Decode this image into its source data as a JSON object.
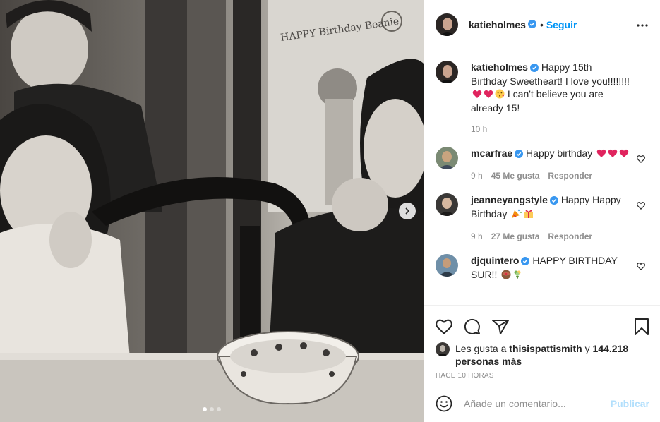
{
  "colors": {
    "accent": "#0095f6",
    "text": "#262626",
    "secondary": "#8e8e8e",
    "verified": "#3897f0",
    "publish_disabled": "#b2dffc",
    "heart_emoji": "#e0245e"
  },
  "media": {
    "caption_on_wall": "HAPPY Birthday Beanie",
    "carousel_pages": 3,
    "carousel_active": 1
  },
  "header": {
    "username": "katieholmes",
    "separator": "•",
    "follow_label": "Seguir",
    "more_icon": "more-horizontal-icon"
  },
  "caption": {
    "username": "katieholmes",
    "text_1": "Happy 15th Birthday Sweetheart! I love you!!!!!!!! ",
    "text_2": " I can't believe you are already 15!",
    "time": "10 h"
  },
  "comments": [
    {
      "username": "mcarfrae",
      "text": "Happy birthday ",
      "time": "9 h",
      "likes": "45 Me gusta",
      "reply": "Responder"
    },
    {
      "username": "jeanneyangstyle",
      "text": "Happy Happy Birthday ",
      "time": "9 h",
      "likes": "27 Me gusta",
      "reply": "Responder"
    },
    {
      "username": "djquintero",
      "text": "HAPPY BIRTHDAY SUR!! "
    }
  ],
  "actions": {
    "liked_by_prefix": "Les gusta a",
    "liked_by_user": "thisispattismith",
    "liked_by_and": "y",
    "liked_by_others": "144.218 personas más",
    "posted_ago": "HACE 10 HORAS"
  },
  "add_comment": {
    "placeholder": "Añade un comentario...",
    "publish_label": "Publicar"
  }
}
